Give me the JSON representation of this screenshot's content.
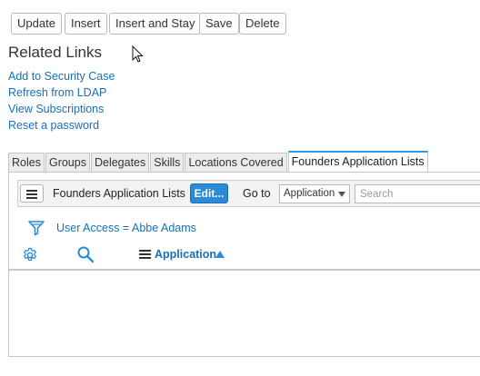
{
  "buttons": {
    "update": "Update",
    "insert": "Insert",
    "insert_and_stay": "Insert and Stay",
    "save": "Save",
    "delete": "Delete"
  },
  "related_links": {
    "title": "Related Links",
    "items": [
      "Add to Security Case",
      "Refresh from LDAP",
      "View Subscriptions",
      "Reset a password"
    ]
  },
  "tabs": [
    "Roles",
    "Groups",
    "Delegates",
    "Skills",
    "Locations Covered",
    "Founders Application Lists"
  ],
  "active_tab": "Founders Application Lists",
  "list": {
    "title": "Founders Application Lists",
    "edit_label": "Edit...",
    "goto_label": "Go to",
    "goto_selected": "Application",
    "search_placeholder": "Search",
    "filter_breadcrumb": "User Access = Abbe Adams",
    "column_header": "Application",
    "sort": "ascending"
  },
  "colors": {
    "link": "#1a6fb8",
    "accent": "#2b8ad6",
    "active_tab_border": "#2e9fdf"
  },
  "icons": [
    "filter-icon",
    "gear-icon",
    "search-icon",
    "hamburger-menu-icon",
    "sort-ascending-icon",
    "mouse-cursor-icon"
  ]
}
